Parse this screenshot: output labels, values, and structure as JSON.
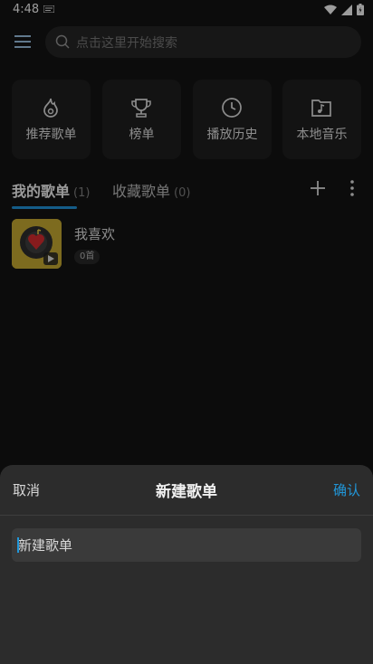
{
  "status_bar": {
    "time": "4:48"
  },
  "search": {
    "placeholder": "点击这里开始搜索"
  },
  "quick_cards": [
    {
      "label": "推荐歌单",
      "icon": "flame-icon"
    },
    {
      "label": "榜单",
      "icon": "trophy-icon"
    },
    {
      "label": "播放历史",
      "icon": "clock-icon"
    },
    {
      "label": "本地音乐",
      "icon": "music-folder-icon"
    }
  ],
  "tabs": {
    "my_playlists": {
      "label": "我的歌单",
      "count": "(1)"
    },
    "favorites": {
      "label": "收藏歌单",
      "count": "(0)"
    }
  },
  "playlist": {
    "name": "我喜欢",
    "count": "0首"
  },
  "sheet": {
    "cancel": "取消",
    "title": "新建歌单",
    "confirm": "确认",
    "input_value": "新建歌单"
  },
  "colors": {
    "accent": "#2196d8",
    "background": "#121212",
    "sheet": "#2c2c2c"
  }
}
